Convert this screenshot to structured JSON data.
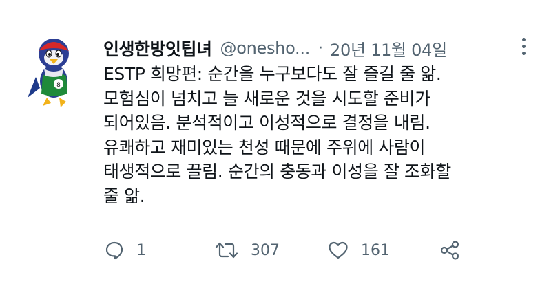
{
  "tweet": {
    "display_name": "인생한방잇팁녀",
    "handle": "@onesho...",
    "separator": "·",
    "date": "20년 11월 04일",
    "lines": [
      "ESTP 희망편: 순간을 누구보다도 잘 즐길 줄 앎.",
      "모험심이 넘치고 늘 새로운 것을 시도할 준비가",
      "되어있음. 분석적이고 이성적으로 결정을 내림.",
      "유쾌하고 재미있는 천성 때문에 주위에 사람이",
      "태생적으로 끌림. 순간의 충동과 이성을 잘 조화할",
      "줄 앎."
    ]
  },
  "actions": {
    "reply_count": "1",
    "retweet_count": "307",
    "like_count": "161"
  },
  "icons": {
    "avatar": "bird-mascot-avatar",
    "more": "more-vertical-icon",
    "reply": "reply-icon",
    "retweet": "retweet-icon",
    "like": "heart-icon",
    "share": "share-icon"
  },
  "colors": {
    "text": "#0f1419",
    "secondary": "#536471"
  }
}
